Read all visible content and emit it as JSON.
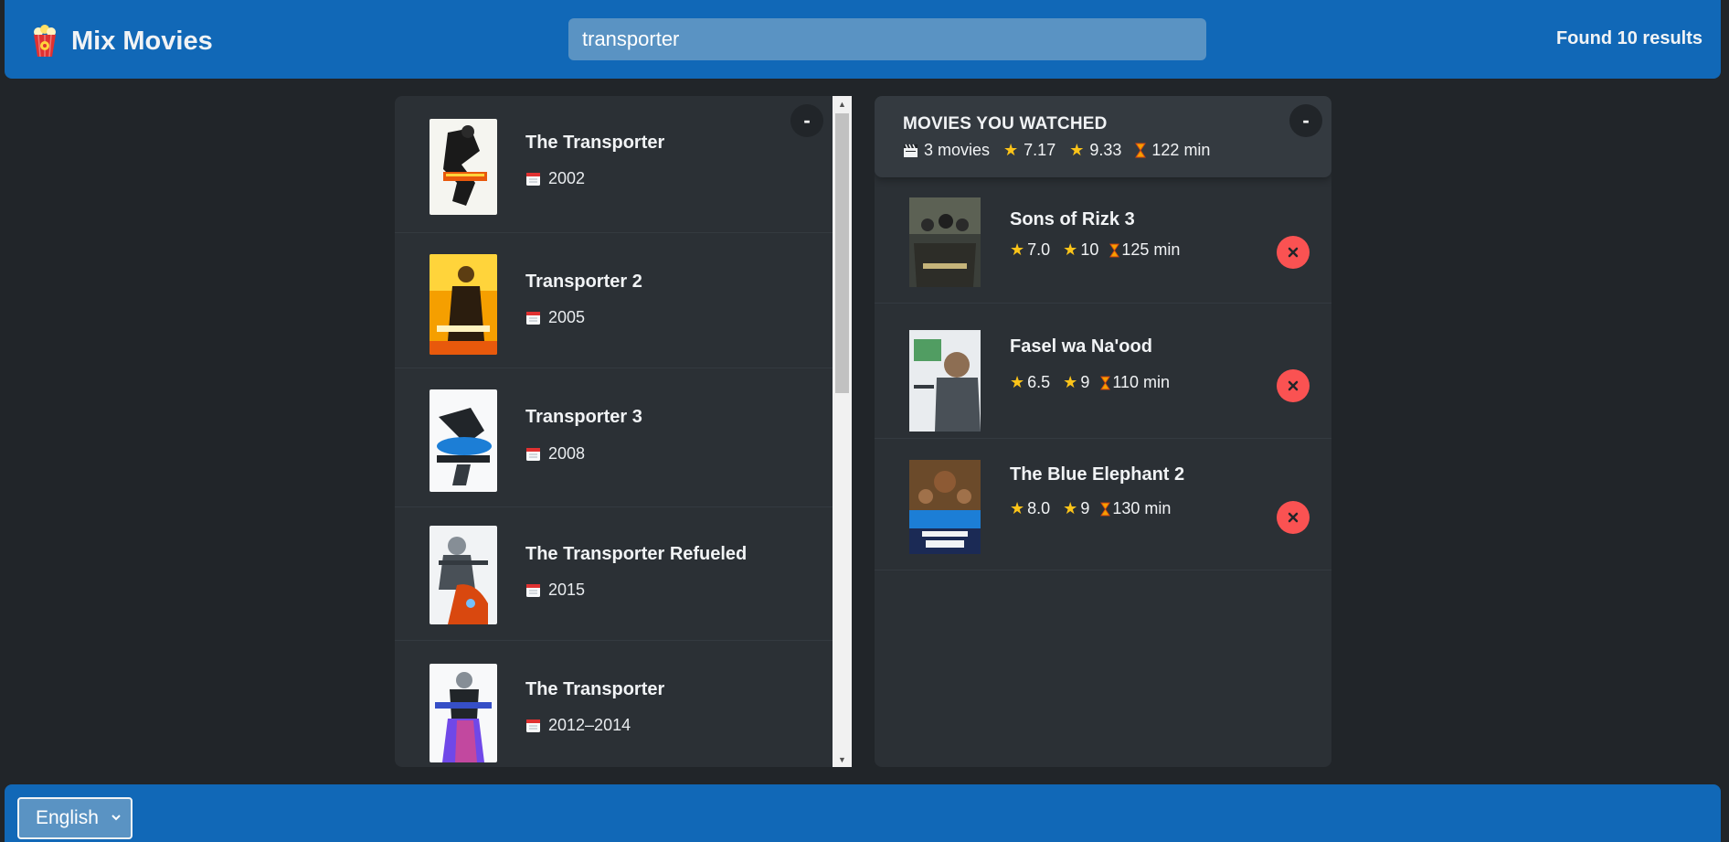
{
  "app": {
    "title": "Mix Movies",
    "logo_icon": "popcorn-icon"
  },
  "search": {
    "value": "transporter",
    "results_text": "Found 10 results"
  },
  "results_list": [
    {
      "title": "The Transporter",
      "year": "2002"
    },
    {
      "title": "Transporter 2",
      "year": "2005"
    },
    {
      "title": "Transporter 3",
      "year": "2008"
    },
    {
      "title": "The Transporter Refueled",
      "year": "2015"
    },
    {
      "title": "The Transporter",
      "year": "2012–2014"
    }
  ],
  "watched": {
    "heading": "MOVIES YOU WATCHED",
    "count_text": "3 movies",
    "avg_imdb_rating": "7.17",
    "avg_user_rating": "9.33",
    "avg_runtime": "122 min",
    "movies": [
      {
        "title": "Sons of Rizk 3",
        "imdb_rating": "7.0",
        "user_rating": "10",
        "runtime": "125 min"
      },
      {
        "title": "Fasel wa Na'ood",
        "imdb_rating": "6.5",
        "user_rating": "9",
        "runtime": "110 min"
      },
      {
        "title": "The Blue Elephant 2",
        "imdb_rating": "8.0",
        "user_rating": "9",
        "runtime": "130 min"
      }
    ]
  },
  "toggle_label": "-",
  "footer": {
    "language": "English"
  },
  "colors": {
    "header_bg": "#1168b7",
    "body_bg": "#212529",
    "panel_bg": "#2b3035",
    "delete_red": "#fa5252",
    "star_yellow": "#fcc419"
  }
}
